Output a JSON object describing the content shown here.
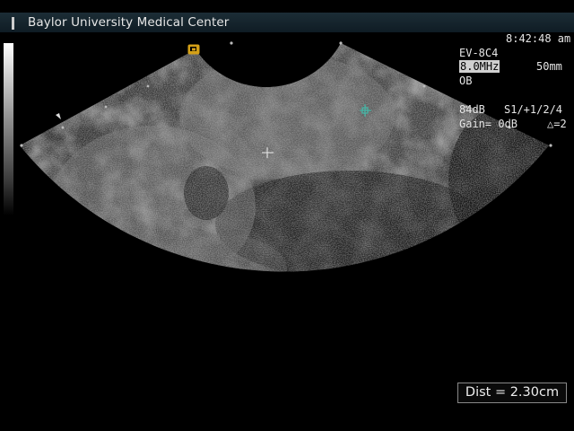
{
  "header": {
    "institution": "Baylor University Medical Center"
  },
  "info_panel": {
    "time": "8:42:48 am",
    "probe": "EV-8C4",
    "frequency": "8.0MHz",
    "depth": "50mm",
    "preset": "OB",
    "dynamic_range": "84dB",
    "settings": "S1/+1/2/4",
    "gain": "Gain= 0dB",
    "delta": "△=2"
  },
  "measurement": {
    "label": "Dist = 2.30cm"
  },
  "colors": {
    "background": "#000000",
    "caliper": "#44b8a8",
    "text": "#e6e6e6"
  }
}
